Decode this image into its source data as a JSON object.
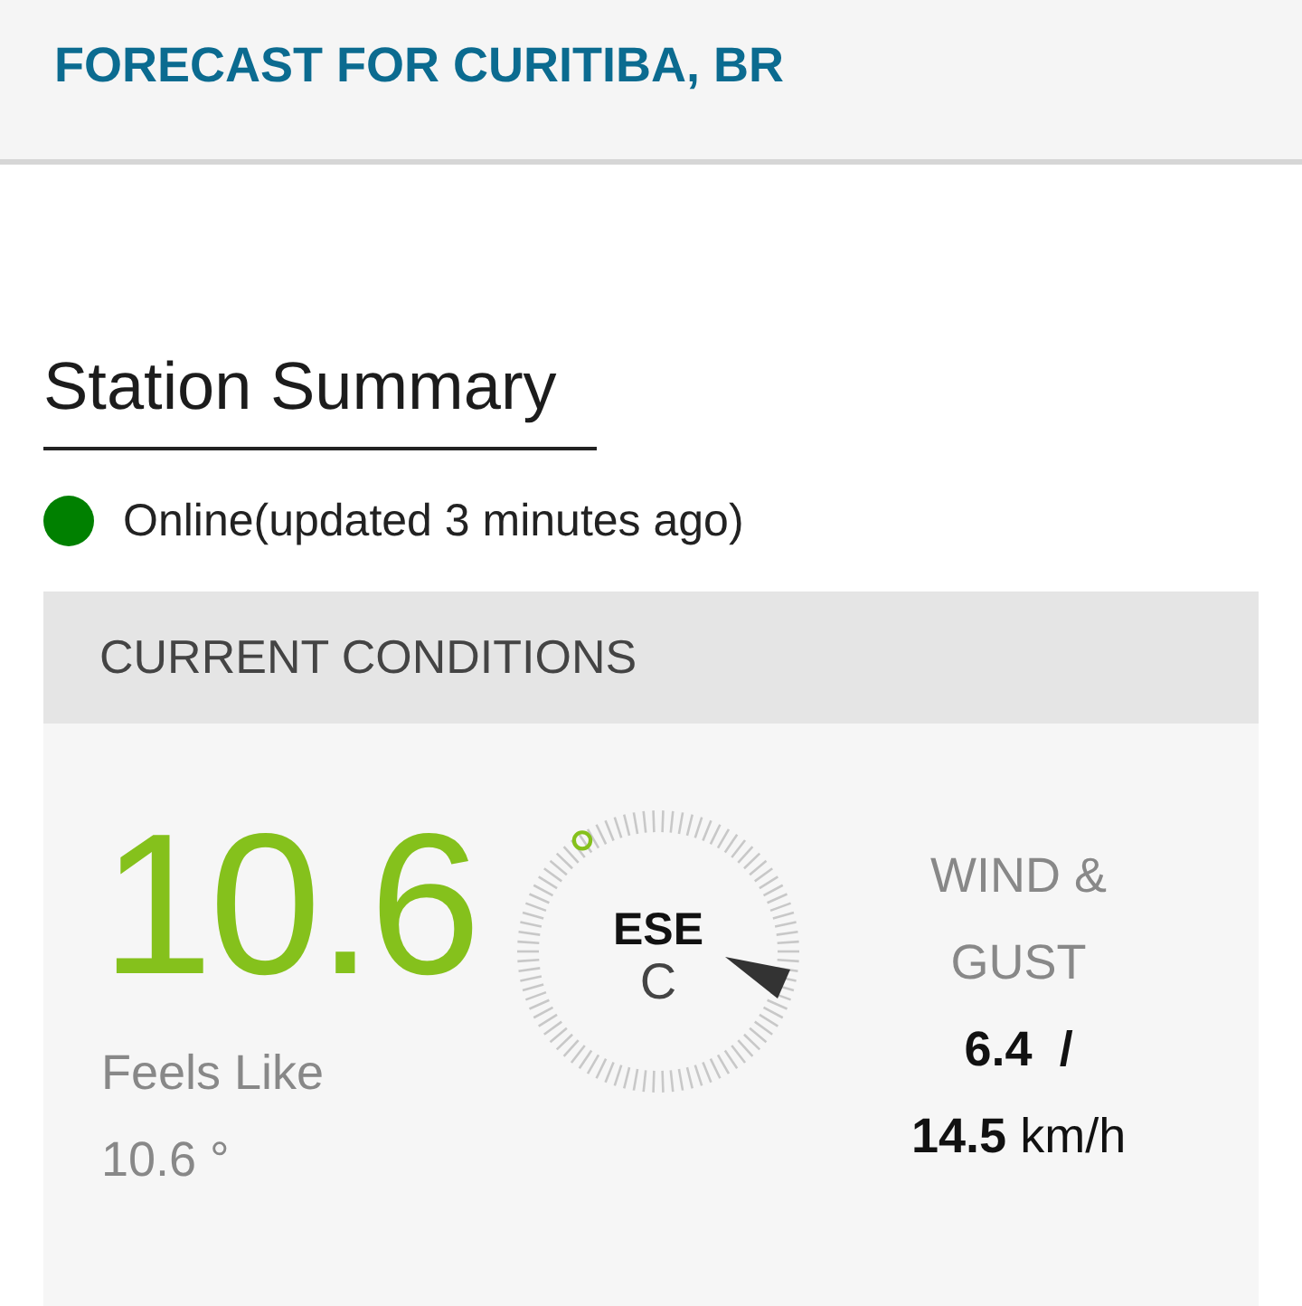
{
  "header": {
    "title": "FORECAST FOR CURITIBA, BR"
  },
  "station": {
    "heading": "Station Summary",
    "status": {
      "color": "#008000",
      "text": "Online(updated 3 minutes ago)"
    }
  },
  "current_conditions": {
    "title": "CURRENT CONDITIONS",
    "temperature": "10.6",
    "degree": "°",
    "feels_like_label": "Feels Like",
    "feels_like": "10.6 °",
    "compass": {
      "direction": "ESE",
      "unit": "C"
    },
    "wind": {
      "label_line_1": "WIND &",
      "label_line_2": "GUST",
      "speed": "6.4",
      "separator": "/",
      "gust": "14.5",
      "unit": "km/h"
    }
  }
}
